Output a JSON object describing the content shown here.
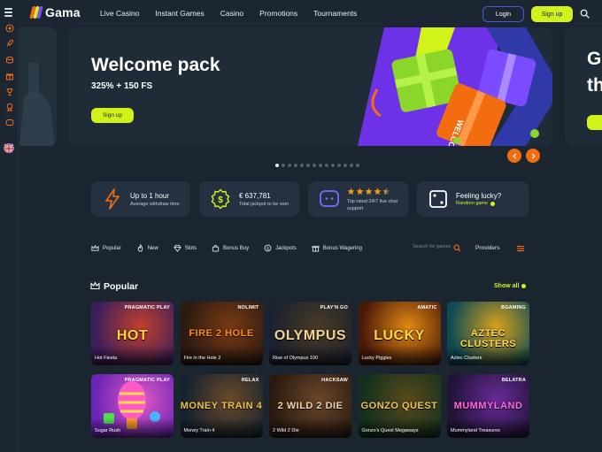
{
  "header": {
    "logo": "Gama",
    "nav": [
      "Live Casino",
      "Instant Games",
      "Casino",
      "Promotions",
      "Tournaments"
    ],
    "login_label": "Login",
    "signup_label": "Sign up"
  },
  "sidebar": {
    "icons": [
      "roulette-icon",
      "rocket-icon",
      "coins-icon",
      "gift-icon",
      "trophy-icon",
      "medal-icon",
      "chat-icon",
      "uk-flag-icon"
    ]
  },
  "hero": {
    "title": "Welcome pack",
    "subtitle": "325% + 150 FS",
    "button_label": "Sign up",
    "peek_right_letters": [
      "G",
      "th"
    ],
    "slide_count": 14,
    "active_slide": 1
  },
  "features": [
    {
      "title": "Up to 1 hour",
      "desc": "Average withdraw time"
    },
    {
      "title": "€  637,781",
      "desc": "Total jackpot to be won"
    },
    {
      "title": "",
      "desc": "Top rated 24/7 live chat support",
      "rating": 4.5
    },
    {
      "title": "Feeling lucky?",
      "desc": "Random game"
    }
  ],
  "filters": [
    "Popular",
    "New",
    "Slots",
    "Bonus Buy",
    "Jackpots",
    "Bonus Wagering"
  ],
  "search_placeholder": "Search for games",
  "providers_label": "Providers",
  "section": {
    "title": "Popular",
    "show_all": "Show all"
  },
  "games": [
    {
      "name": "Hot Fiesta",
      "provider": "PRAGMATIC PLAY",
      "art": "HOT",
      "color1": "#3b1e5c",
      "color2": "#c2402b",
      "textcolor": "#ffd23c"
    },
    {
      "name": "Fire in the Hole 2",
      "provider": "NOLIMIT",
      "art": "FIRE 2 HOLE",
      "color1": "#2b1a10",
      "color2": "#7a3a14",
      "textcolor": "#ff8a1c"
    },
    {
      "name": "Rise of Olympus 100",
      "provider": "PLAY'N GO",
      "art": "OLYMPUS",
      "color1": "#1a2130",
      "color2": "#4a3a24",
      "textcolor": "#f0d590"
    },
    {
      "name": "Lucky Piggies",
      "provider": "AMATIC",
      "art": "LUCKY",
      "color1": "#4a1808",
      "color2": "#e28a12",
      "textcolor": "#ffd64a"
    },
    {
      "name": "Aztec Clusters",
      "provider": "BGAMING",
      "art": "AZTEC CLUSTERS",
      "color1": "#0f4a52",
      "color2": "#d8a31c",
      "textcolor": "#ffdc4c"
    },
    {
      "name": "Sugar Rush",
      "provider": "PRAGMATIC PLAY",
      "art": "",
      "color1": "#6a24b6",
      "color2": "#e25ac2",
      "textcolor": "#fff"
    },
    {
      "name": "Money Train 4",
      "provider": "RELAX",
      "art": "MONEY TRAIN 4",
      "color1": "#16222e",
      "color2": "#6a4a2a",
      "textcolor": "#f2c24a"
    },
    {
      "name": "2 Wild 2 Die",
      "provider": "HACKSAW",
      "art": "2 WILD 2 DIE",
      "color1": "#2a1a10",
      "color2": "#6a4628",
      "textcolor": "#f0d8a8"
    },
    {
      "name": "Gonzo's Quest Megaways",
      "provider": "",
      "art": "GONZO QUEST",
      "color1": "#12301e",
      "color2": "#5a4a1a",
      "textcolor": "#f0c85a"
    },
    {
      "name": "Mummyland Treasures",
      "provider": "BELATRA",
      "art": "MUMMYLAND",
      "color1": "#1f1436",
      "color2": "#6a2a9a",
      "textcolor": "#ff6ae0"
    }
  ],
  "colors": {
    "accent": "#d2f31a",
    "bg": "#1b2530",
    "card": "#253140",
    "orange": "#f36d10",
    "login_border": "#4b57d8"
  }
}
